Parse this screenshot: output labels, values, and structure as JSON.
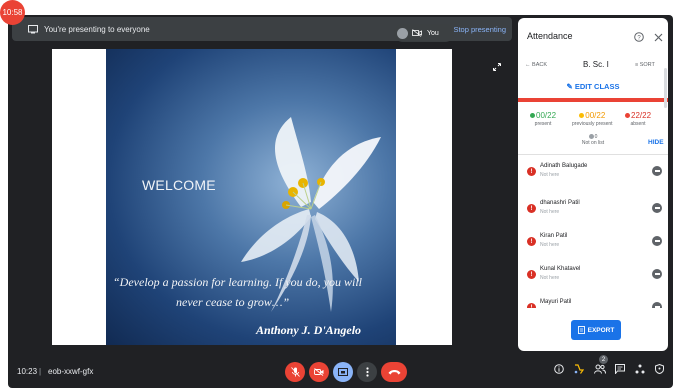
{
  "recording_timer": "10:58",
  "presenting_bar": {
    "message": "You're presenting to everyone",
    "stop_label": "Stop presenting"
  },
  "self_tile": {
    "label": "You"
  },
  "slide": {
    "welcome": "WELCOME",
    "quote_line1": "“Develop a passion for learning. If you do, you will",
    "quote_line2": "never cease to grow…”",
    "author": "Anthony J. D'Angelo"
  },
  "bottom_bar": {
    "time": "10:23",
    "separator": "|",
    "meeting_code": "eob-xxwf-gfx",
    "participant_count": "2"
  },
  "attendance": {
    "title": "Attendance",
    "back_label": "← BACK",
    "class_name": "B. Sc. I",
    "sort_label": "≡ SORT",
    "edit_label": "EDIT CLASS",
    "stats": [
      {
        "value": "00/22",
        "label": "present",
        "color": "#34a853"
      },
      {
        "value": "00/22",
        "label": "previously present",
        "color": "#fbbc04"
      },
      {
        "value": "22/22",
        "label": "absent",
        "color": "#ea4335"
      }
    ],
    "not_on_list_count": "0",
    "not_on_list_label": "Not on list",
    "hide_label": "HIDE",
    "students": [
      {
        "name": "Adinath Balugade",
        "status": "Not here"
      },
      {
        "name": "dhanashri Patil",
        "status": "Not here"
      },
      {
        "name": "Kiran Patil",
        "status": "Not here"
      },
      {
        "name": "Kunal Khatavel",
        "status": "Not here"
      },
      {
        "name": "Mayuri Patil",
        "status": ""
      }
    ],
    "export_label": "EXPORT"
  },
  "colors": {
    "meet_bg": "#202124",
    "accent_blue": "#1a73e8",
    "alert_red": "#ea4335"
  },
  "icons": [
    "screen-share-icon",
    "mic-off-icon",
    "camera-off-icon",
    "present-icon",
    "more-icon",
    "hang-up-icon",
    "info-icon",
    "people-icon",
    "chat-icon",
    "activities-icon",
    "shield-icon",
    "help-icon",
    "close-icon",
    "pencil-icon",
    "download-icon",
    "expand-icon"
  ]
}
